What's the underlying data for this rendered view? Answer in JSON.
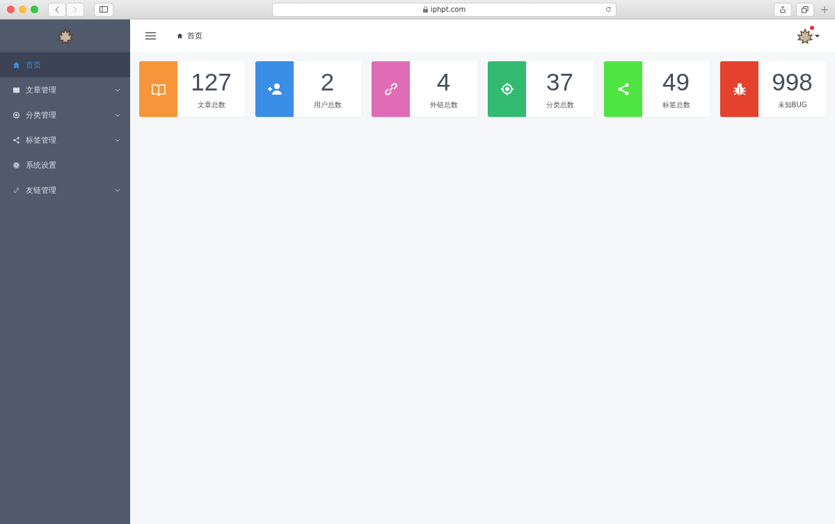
{
  "browser": {
    "address": "iphpt.com"
  },
  "sidebar": {
    "items": [
      {
        "label": "首页",
        "selected": true,
        "expandable": false
      },
      {
        "label": "文章管理",
        "selected": false,
        "expandable": true
      },
      {
        "label": "分类管理",
        "selected": false,
        "expandable": true
      },
      {
        "label": "标签管理",
        "selected": false,
        "expandable": true
      },
      {
        "label": "系统设置",
        "selected": false,
        "expandable": false
      },
      {
        "label": "友链管理",
        "selected": false,
        "expandable": true
      }
    ]
  },
  "header": {
    "breadcrumb": "首页",
    "notification": true
  },
  "stats": [
    {
      "value": "127",
      "label": "文章总数",
      "color": "#f7953a"
    },
    {
      "value": "2",
      "label": "用户总数",
      "color": "#3a8ee6"
    },
    {
      "value": "4",
      "label": "外链总数",
      "color": "#e06cb6"
    },
    {
      "value": "37",
      "label": "分类总数",
      "color": "#32bb70"
    },
    {
      "value": "49",
      "label": "标签总数",
      "color": "#4ee442"
    },
    {
      "value": "998",
      "label": "未知BUG",
      "color": "#e5412f"
    }
  ]
}
